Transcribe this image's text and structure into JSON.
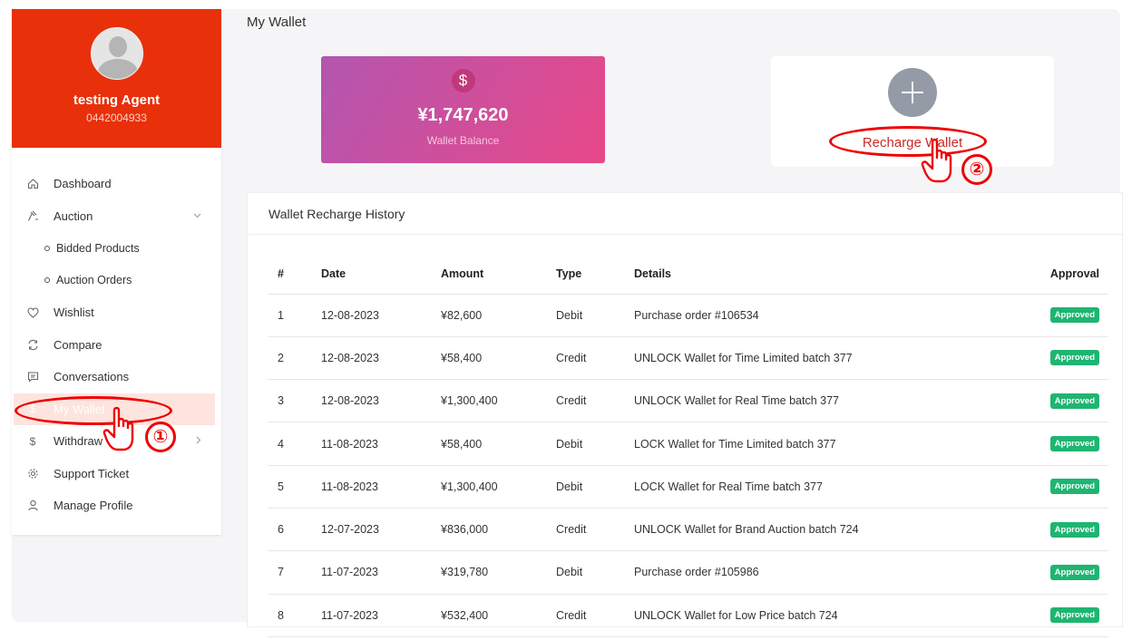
{
  "profile": {
    "name": "testing Agent",
    "phone": "0442004933"
  },
  "sidebar": {
    "items": [
      {
        "label": "Dashboard",
        "icon": "home-icon"
      },
      {
        "label": "Auction",
        "icon": "gavel-icon"
      },
      {
        "label": "Bidded Products",
        "icon": "circle-bullet-icon"
      },
      {
        "label": "Auction Orders",
        "icon": "circle-bullet-icon"
      },
      {
        "label": "Wishlist",
        "icon": "heart-icon"
      },
      {
        "label": "Compare",
        "icon": "refresh-icon"
      },
      {
        "label": "Conversations",
        "icon": "chat-icon"
      },
      {
        "label": "My Wallet",
        "icon": "dollar-icon"
      },
      {
        "label": "Withdraw",
        "icon": "dollar-icon"
      },
      {
        "label": "Support Ticket",
        "icon": "gear-icon"
      },
      {
        "label": "Manage Profile",
        "icon": "user-icon"
      }
    ]
  },
  "main": {
    "title": "My Wallet",
    "balance": {
      "amount": "¥1,747,620",
      "label": "Wallet Balance"
    },
    "recharge": {
      "label": "Recharge Wallet"
    },
    "history": {
      "title": "Wallet Recharge History",
      "columns": [
        "#",
        "Date",
        "Amount",
        "Type",
        "Details",
        "Approval"
      ],
      "rows": [
        [
          "1",
          "12-08-2023",
          "¥82,600",
          "Debit",
          "Purchase order #106534",
          "Approved"
        ],
        [
          "2",
          "12-08-2023",
          "¥58,400",
          "Credit",
          "UNLOCK Wallet for Time Limited batch 377",
          "Approved"
        ],
        [
          "3",
          "12-08-2023",
          "¥1,300,400",
          "Credit",
          "UNLOCK Wallet for Real Time batch 377",
          "Approved"
        ],
        [
          "4",
          "11-08-2023",
          "¥58,400",
          "Debit",
          "LOCK Wallet for Time Limited batch 377",
          "Approved"
        ],
        [
          "5",
          "11-08-2023",
          "¥1,300,400",
          "Debit",
          "LOCK Wallet for Real Time batch 377",
          "Approved"
        ],
        [
          "6",
          "12-07-2023",
          "¥836,000",
          "Credit",
          "UNLOCK Wallet for Brand Auction batch 724",
          "Approved"
        ],
        [
          "7",
          "11-07-2023",
          "¥319,780",
          "Debit",
          "Purchase order #105986",
          "Approved"
        ],
        [
          "8",
          "11-07-2023",
          "¥532,400",
          "Credit",
          "UNLOCK Wallet for Low Price batch 724",
          "Approved"
        ]
      ]
    }
  },
  "annotations": {
    "step1": "①",
    "step2": "②"
  },
  "colors": {
    "brand": "#e8300b",
    "annotation": "#ee0000",
    "approved": "#1eb571"
  }
}
